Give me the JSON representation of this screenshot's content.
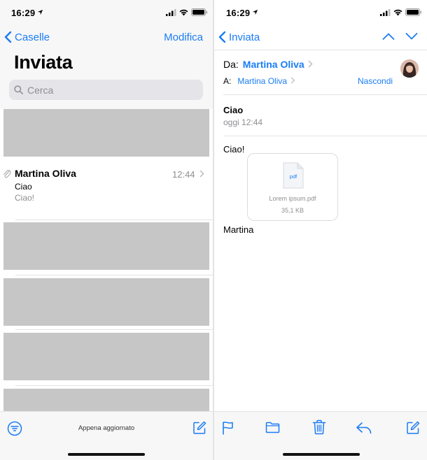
{
  "left": {
    "status": {
      "time": "16:29"
    },
    "nav": {
      "back_label": "Caselle",
      "edit_label": "Modifica"
    },
    "title": "Inviata",
    "search": {
      "placeholder": "Cerca"
    },
    "message": {
      "sender": "Martina Oliva",
      "time": "12:44",
      "subject": "Ciao",
      "preview": "Ciao!"
    },
    "toolbar": {
      "status_text": "Appena aggiornato"
    }
  },
  "right": {
    "status": {
      "time": "16:29"
    },
    "nav": {
      "back_label": "Inviata"
    },
    "from_label": "Da:",
    "from_name": "Martina Oliva",
    "to_label": "A:",
    "to_name": "Martina Oliva",
    "hide_label": "Nascondi",
    "subject": "Ciao",
    "date": "oggi 12:44",
    "body_greeting": "Ciao!",
    "attachment": {
      "file_type": "pdf",
      "file_name": "Lorem ipsum.pdf",
      "file_size": "35,1 KB"
    },
    "body_signature": "Martina"
  },
  "colors": {
    "accent": "#1a7cf5",
    "secondary_text": "#8e8e93",
    "placeholder_block": "#c6c6c6"
  }
}
